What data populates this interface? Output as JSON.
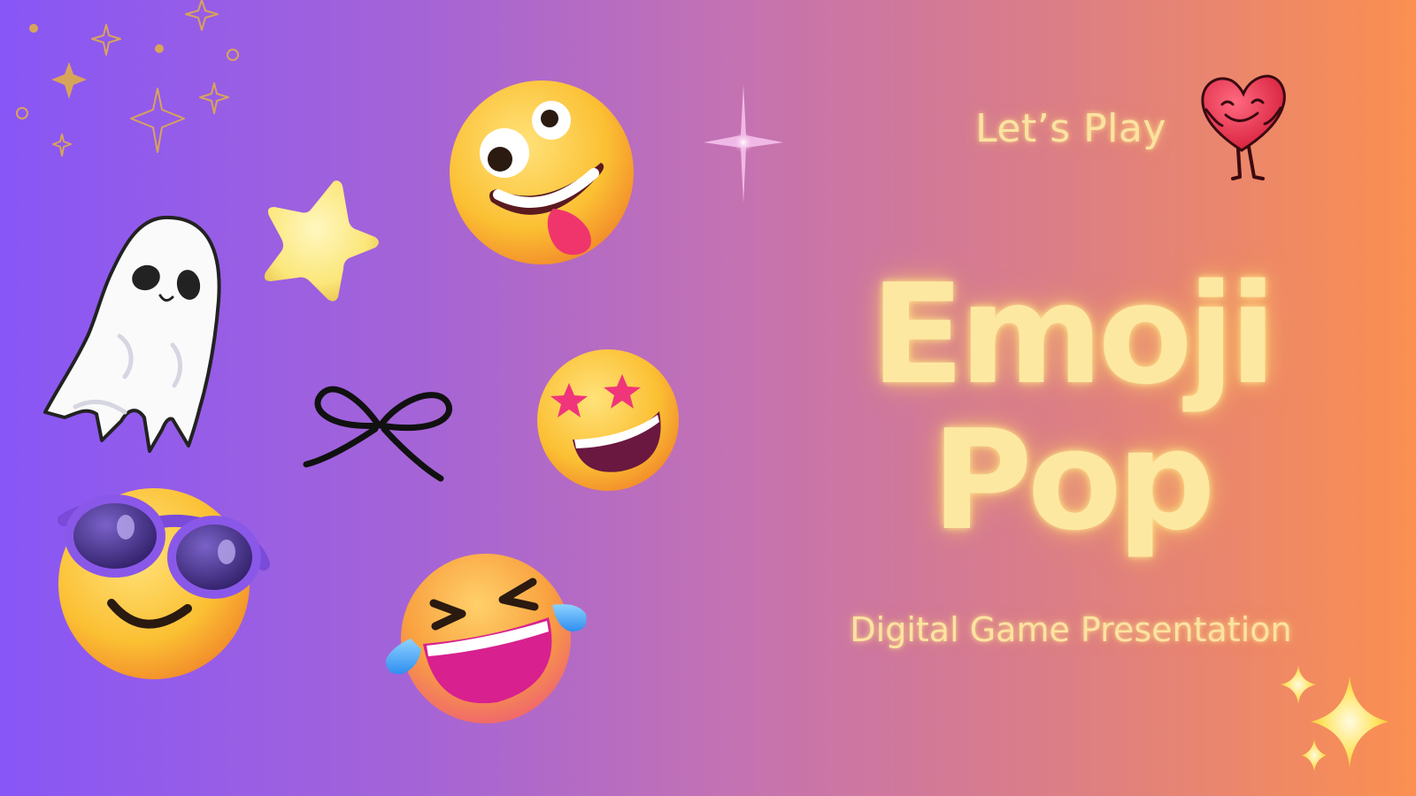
{
  "slide": {
    "kicker": "Let’s Play",
    "title_line1": "Emoji",
    "title_line2": "Pop",
    "subtitle": "Digital Game Presentation"
  },
  "decorations": {
    "icons": [
      "sparkle-cluster-icon",
      "twinkle-star-icon",
      "yellow-star-icon",
      "ghost-icon",
      "zany-face-emoji-icon",
      "ribbon-bow-icon",
      "star-struck-emoji-icon",
      "sunglasses-smile-emoji-icon",
      "tears-of-joy-emoji-icon",
      "heart-character-icon",
      "gold-sparkles-icon"
    ]
  },
  "colors": {
    "gradient_start": "#8856f6",
    "gradient_end": "#fb9050",
    "title_glow": "#fde8a2"
  }
}
